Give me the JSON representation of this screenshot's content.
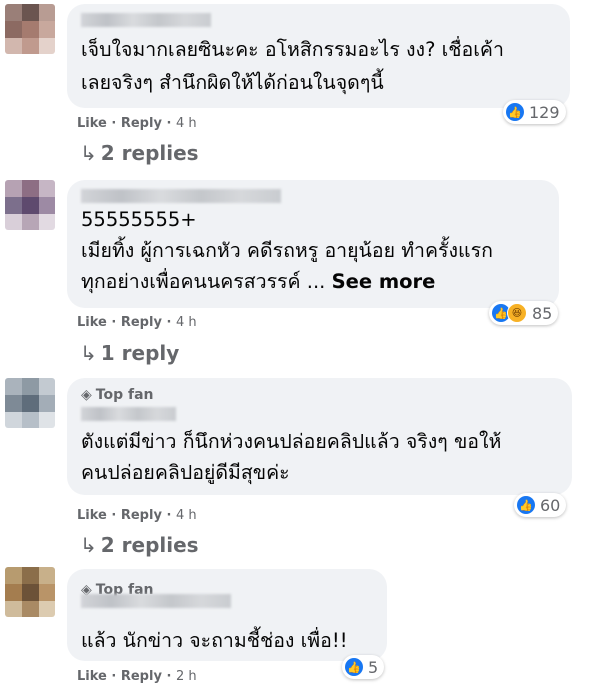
{
  "comments": [
    {
      "top_fan": false,
      "text_lines": [
        "เจ็บใจมากเลยซินะคะ อโหสิกรรมอะไร งง? เชื่อเค้า",
        "เลยจริงๆ สำนึกผิดให้ได้ก่อนในจุดๆนี้"
      ],
      "reactions": {
        "icons": [
          "like-icon"
        ],
        "count": "129"
      },
      "actions": {
        "like": "Like",
        "reply": "Reply",
        "time": "4 h"
      },
      "replies_label": "2 replies"
    },
    {
      "top_fan": false,
      "text_lines": [
        "55555555+",
        "เมียทิ้ง ผู้การเฉกหัว คดีรถหรู อายุน้อย ทำครั้งแรก",
        "ทุกอย่างเพื่อคนนครสวรรค์ ..."
      ],
      "see_more": "See more",
      "reactions": {
        "icons": [
          "like-icon",
          "haha-icon"
        ],
        "count": "85"
      },
      "actions": {
        "like": "Like",
        "reply": "Reply",
        "time": "4 h"
      },
      "replies_label": "1 reply"
    },
    {
      "top_fan": true,
      "top_fan_label": "Top fan",
      "text_lines": [
        "ตังแต่มีข่าว ก็นึกห่วงคนปล่อยคลิปแล้ว จริงๆ ขอให้",
        "คนปล่อยคลิปอยู่ดีมีสุขค่ะ"
      ],
      "reactions": {
        "icons": [
          "like-icon"
        ],
        "count": "60"
      },
      "actions": {
        "like": "Like",
        "reply": "Reply",
        "time": "4 h"
      },
      "replies_label": "2 replies"
    },
    {
      "top_fan": true,
      "top_fan_label": "Top fan",
      "text_lines": [
        "แล้ว นักข่าว จะถามชี้ช่อง เพื่อ!!"
      ],
      "reactions": {
        "icons": [
          "like-icon"
        ],
        "count": "5"
      },
      "actions": {
        "like": "Like",
        "reply": "Reply",
        "time": "2 h"
      }
    }
  ],
  "colors": {
    "bubble": "#f0f2f5",
    "like_blue": "#1877f2",
    "haha_yellow": "#f7b125",
    "meta_gray": "#65676b"
  }
}
